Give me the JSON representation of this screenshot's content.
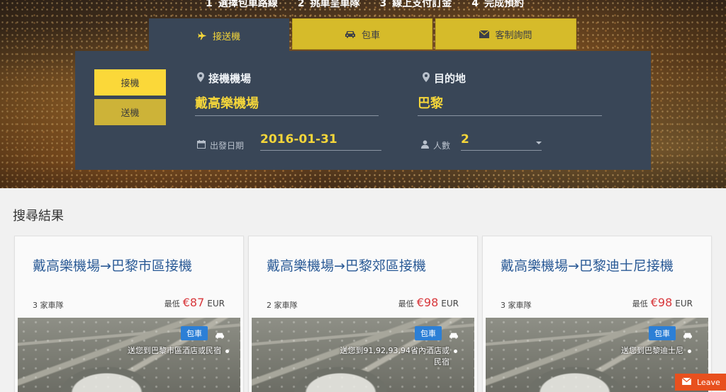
{
  "steps": [
    {
      "num": "1",
      "label": "選擇包車路線"
    },
    {
      "num": "2",
      "label": "挑車呈車隊"
    },
    {
      "num": "3",
      "label": "線上支付訂金"
    },
    {
      "num": "4",
      "label": "完成預約"
    }
  ],
  "tabs": {
    "transfer": {
      "label": "接送機",
      "icon": "plane-icon"
    },
    "charter": {
      "label": "包車",
      "icon": "car-icon"
    },
    "contact": {
      "label": "客制詢問",
      "icon": "envelope-icon"
    }
  },
  "panel": {
    "mode_pickup": "接機",
    "mode_dropoff": "送機",
    "airport_label": "接機機場",
    "airport_value": "戴高樂機場",
    "destination_label": "目的地",
    "destination_value": "巴黎",
    "date_label": "出發日期",
    "date_value": "2016-01-31",
    "people_label": "人數",
    "people_value": "2"
  },
  "results": {
    "title": "搜尋結果",
    "cards": [
      {
        "title": "戴高樂機場→巴黎市區接機",
        "fleet": "3 家車隊",
        "price_prefix": "最低",
        "price": "€87",
        "currency": "EUR",
        "badge": "包車",
        "desc_line1": "送您到巴黎市區酒店或民宿",
        "desc_line2": ""
      },
      {
        "title": "戴高樂機場→巴黎郊區接機",
        "fleet": "2 家車隊",
        "price_prefix": "最低",
        "price": "€98",
        "currency": "EUR",
        "badge": "包車",
        "desc_line1": "送您到91,92,93,94省內酒店或",
        "desc_line2": "民宿"
      },
      {
        "title": "戴高樂機場→巴黎迪士尼接機",
        "fleet": "3 家車隊",
        "price_prefix": "最低",
        "price": "€98",
        "currency": "EUR",
        "badge": "包車",
        "desc_line1": "送您到巴黎迪士尼",
        "desc_line2": ""
      }
    ]
  },
  "leave_widget": {
    "label": "Leave"
  },
  "colors": {
    "panel_bg": "#394657",
    "accent_yellow": "#f5d63a",
    "price_red": "#d8373b",
    "badge_blue": "#2c7fd6",
    "title_blue": "#2a5a96",
    "leave_orange": "#e8501e"
  }
}
